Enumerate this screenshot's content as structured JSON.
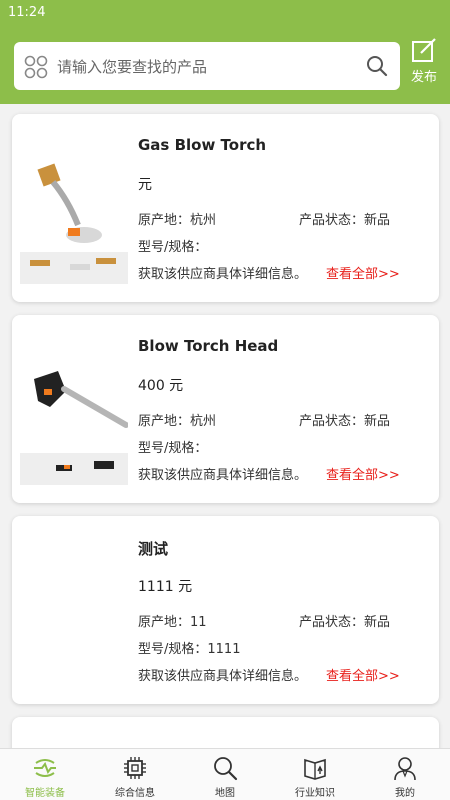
{
  "status_bar": {
    "time": "11:24"
  },
  "header": {
    "search_placeholder": "请输入您要查找的产品",
    "publish_label": "发布"
  },
  "products": [
    {
      "title": "Gas Blow Torch",
      "price": "元",
      "origin": "原产地：杭州",
      "state": "产品状态：新品",
      "model": "型号/规格：",
      "desc": "获取该供应商具体详细信息。",
      "more": "查看全部>>"
    },
    {
      "title": "Blow Torch Head",
      "price": "400 元",
      "origin": "原产地：杭州",
      "state": "产品状态：新品",
      "model": "型号/规格：",
      "desc": "获取该供应商具体详细信息。",
      "more": "查看全部>>"
    },
    {
      "title": "测试",
      "price": "1111 元",
      "origin": "原产地：11",
      "state": "产品状态：新品",
      "model": "型号/规格：1111",
      "desc": "获取该供应商具体详细信息。",
      "more": "查看全部>>"
    }
  ],
  "tabs": [
    {
      "label": "智能装备",
      "icon": "equipment-icon",
      "active": true
    },
    {
      "label": "综合信息",
      "icon": "chip-icon",
      "active": false
    },
    {
      "label": "地图",
      "icon": "map-search-icon",
      "active": false
    },
    {
      "label": "行业知识",
      "icon": "book-icon",
      "active": false
    },
    {
      "label": "我的",
      "icon": "user-icon",
      "active": false
    }
  ],
  "colors": {
    "brand": "#8dbe4a",
    "link": "#e8201b"
  }
}
